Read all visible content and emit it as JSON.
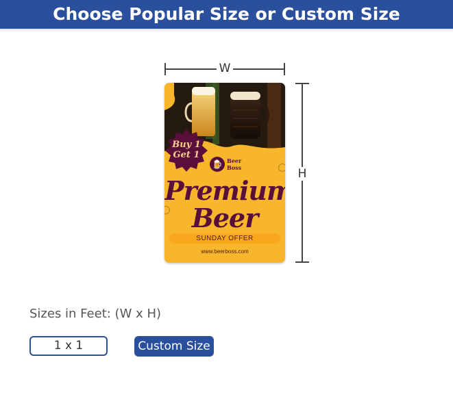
{
  "header": {
    "title": "Choose Popular Size or Custom Size"
  },
  "dimensions": {
    "width_label": "W",
    "height_label": "H"
  },
  "poster": {
    "badge_line1": "Buy 1",
    "badge_line2": "Get 1",
    "brand_line1": "Beer",
    "brand_line2": "Boss",
    "title_line1": "Premium",
    "title_line2": "Beer",
    "offer": "SUNDAY OFFER",
    "url": "www.beerboss.com"
  },
  "sizes": {
    "label": "Sizes in Feet: (W x H)",
    "options": [
      "1 x 1"
    ],
    "custom_button": "Custom Size"
  },
  "colors": {
    "brand_blue": "#2a4f9c",
    "poster_yellow": "#f7b62b",
    "poster_maroon": "#5a0f3b"
  }
}
